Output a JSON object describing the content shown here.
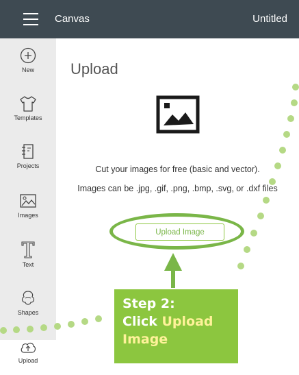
{
  "topbar": {
    "app_title": "Canvas",
    "doc_title": "Untitled"
  },
  "sidebar": {
    "items": [
      {
        "label": "New",
        "icon": "plus-circle-icon"
      },
      {
        "label": "Templates",
        "icon": "tshirt-icon"
      },
      {
        "label": "Projects",
        "icon": "notebook-icon"
      },
      {
        "label": "Images",
        "icon": "image-icon"
      },
      {
        "label": "Text",
        "icon": "text-icon"
      },
      {
        "label": "Shapes",
        "icon": "shapes-icon"
      },
      {
        "label": "Upload",
        "icon": "cloud-upload-icon"
      }
    ]
  },
  "panel": {
    "title": "Upload",
    "description_1": "Cut your images for free (basic and vector).",
    "description_2": "Images can be .jpg, .gif, .png, .bmp, .svg, or .dxf files",
    "upload_button": "Upload Image"
  },
  "callout": {
    "line1": "Step 2:",
    "line2_prefix": "Click ",
    "line2_highlight": "Upload",
    "line3_highlight": "Image"
  },
  "colors": {
    "topbar": "#3e4a52",
    "accent_green": "#8cc63f",
    "highlight_text": "#fff29a",
    "sidebar": "#ebebeb"
  }
}
